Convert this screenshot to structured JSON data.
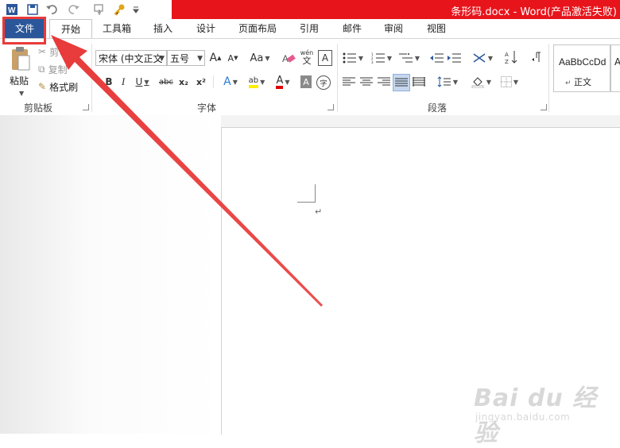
{
  "titlebar": {
    "doc_title": "条形码.docx - Word(产品激活失败)",
    "qat": [
      "word-logo-icon",
      "save-icon",
      "undo-icon",
      "redo-icon",
      "touch-mode-icon",
      "key-icon",
      "customize-qat-icon"
    ]
  },
  "tabs": {
    "file": "文件",
    "items": [
      "开始",
      "工具箱",
      "插入",
      "设计",
      "页面布局",
      "引用",
      "邮件",
      "审阅",
      "视图"
    ],
    "active": "开始"
  },
  "clipboard": {
    "paste": "粘贴",
    "cut": "剪切",
    "copy": "复制",
    "format_painter": "格式刷",
    "label": "剪贴板"
  },
  "font": {
    "font_name": "宋体 (中文正文",
    "font_size": "五号",
    "grow": "A",
    "shrink": "A",
    "case": "Aa",
    "phonetic_top": "wén",
    "phonetic_bottom": "文",
    "border_char": "A",
    "bold": "B",
    "italic": "I",
    "underline": "U",
    "strike": "abc",
    "subscript": "x₂",
    "superscript": "x²",
    "effects": "A",
    "highlight": "ab",
    "color": "A",
    "shading": "A",
    "enclose": "字",
    "label": "字体"
  },
  "paragraph": {
    "label": "段落"
  },
  "styles": {
    "sample": "AaBbCcDd",
    "name": "正文",
    "next": "A"
  },
  "document": {
    "para_mark": "↵"
  },
  "watermark": {
    "brand": "Bai du 经验",
    "url": "jingyan.baidu.com"
  },
  "colors": {
    "title_red": "#e8141b",
    "file_blue": "#2b579a",
    "annotation_red": "#e83a3a"
  }
}
